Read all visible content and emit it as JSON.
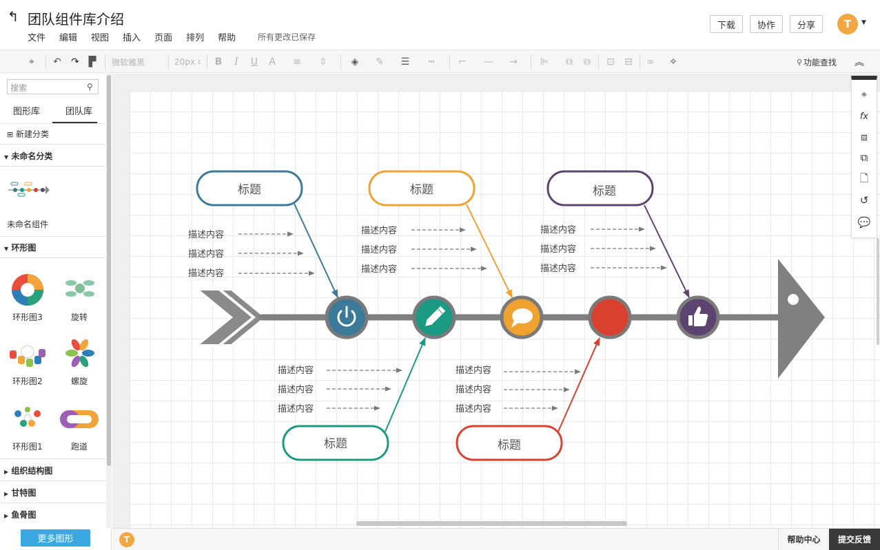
{
  "header": {
    "title": "团队组件库介绍",
    "menu": [
      "文件",
      "编辑",
      "视图",
      "插入",
      "页面",
      "排列",
      "帮助"
    ],
    "save_status": "所有更改已保存",
    "buttons": {
      "download": "下载",
      "collaborate": "协作",
      "share": "分享"
    },
    "avatar_letter": "T"
  },
  "toolbar": {
    "font": "微软雅黑",
    "font_size": "20px",
    "feature_search": "功能查找"
  },
  "sidebar": {
    "search_placeholder": "搜索",
    "tabs": [
      "图形库",
      "团队库"
    ],
    "new_category": "新建分类",
    "categories": {
      "unnamed": {
        "title": "未命名分类",
        "items": [
          "未命名组件"
        ]
      },
      "ring": {
        "title": "环形图",
        "items": [
          "环形图3",
          "旋转",
          "环形图2",
          "螺旋",
          "环形图1",
          "跑道"
        ]
      },
      "collapsed": [
        "组织结构图",
        "甘特图",
        "鱼骨图"
      ]
    },
    "more_shapes": "更多图形"
  },
  "diagram": {
    "title_label": "标题",
    "desc_label": "描述内容",
    "colors": {
      "blue": "#3b7a99",
      "orange": "#f0a230",
      "purple": "#5c4370",
      "green": "#1a9a82",
      "red": "#d9412e",
      "spine": "#808080"
    },
    "icons": [
      "power-icon",
      "pencil-icon",
      "speech-bubble-icon",
      "circle",
      "thumbs-up-icon"
    ]
  },
  "bottom": {
    "avatar_letter": "T",
    "help_center": "帮助中心",
    "feedback": "提交反馈"
  }
}
